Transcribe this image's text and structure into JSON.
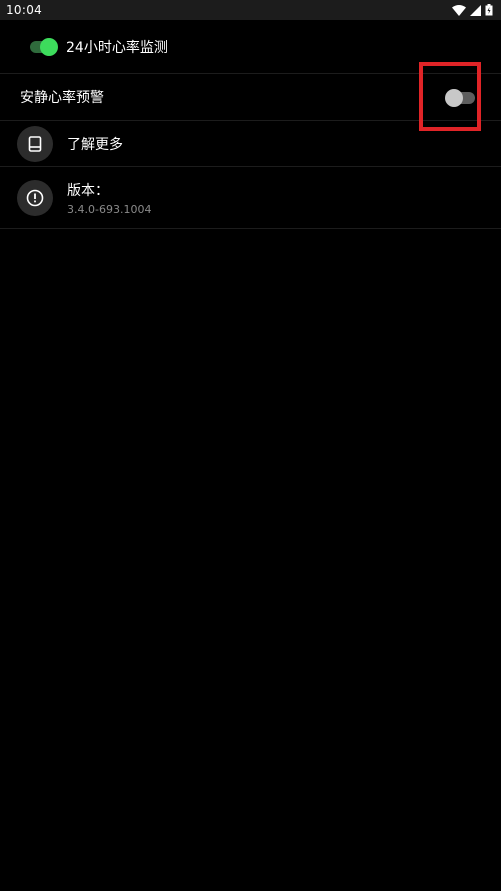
{
  "status_bar": {
    "time": "10:04",
    "icons": [
      "wifi-icon",
      "signal-icon",
      "battery-icon"
    ]
  },
  "settings": {
    "monitor_24h": {
      "label": "24小时心率监测",
      "enabled": true
    },
    "quiet_alert": {
      "label": "安静心率预警",
      "enabled": false
    },
    "learn_more": {
      "label": "了解更多",
      "icon": "book-icon"
    },
    "version": {
      "label": "版本：",
      "value": "3.4.0-693.1004",
      "icon": "info-icon"
    }
  },
  "colors": {
    "background": "#000000",
    "toggle_on": "#3ddc5c",
    "highlight": "#e02427"
  }
}
